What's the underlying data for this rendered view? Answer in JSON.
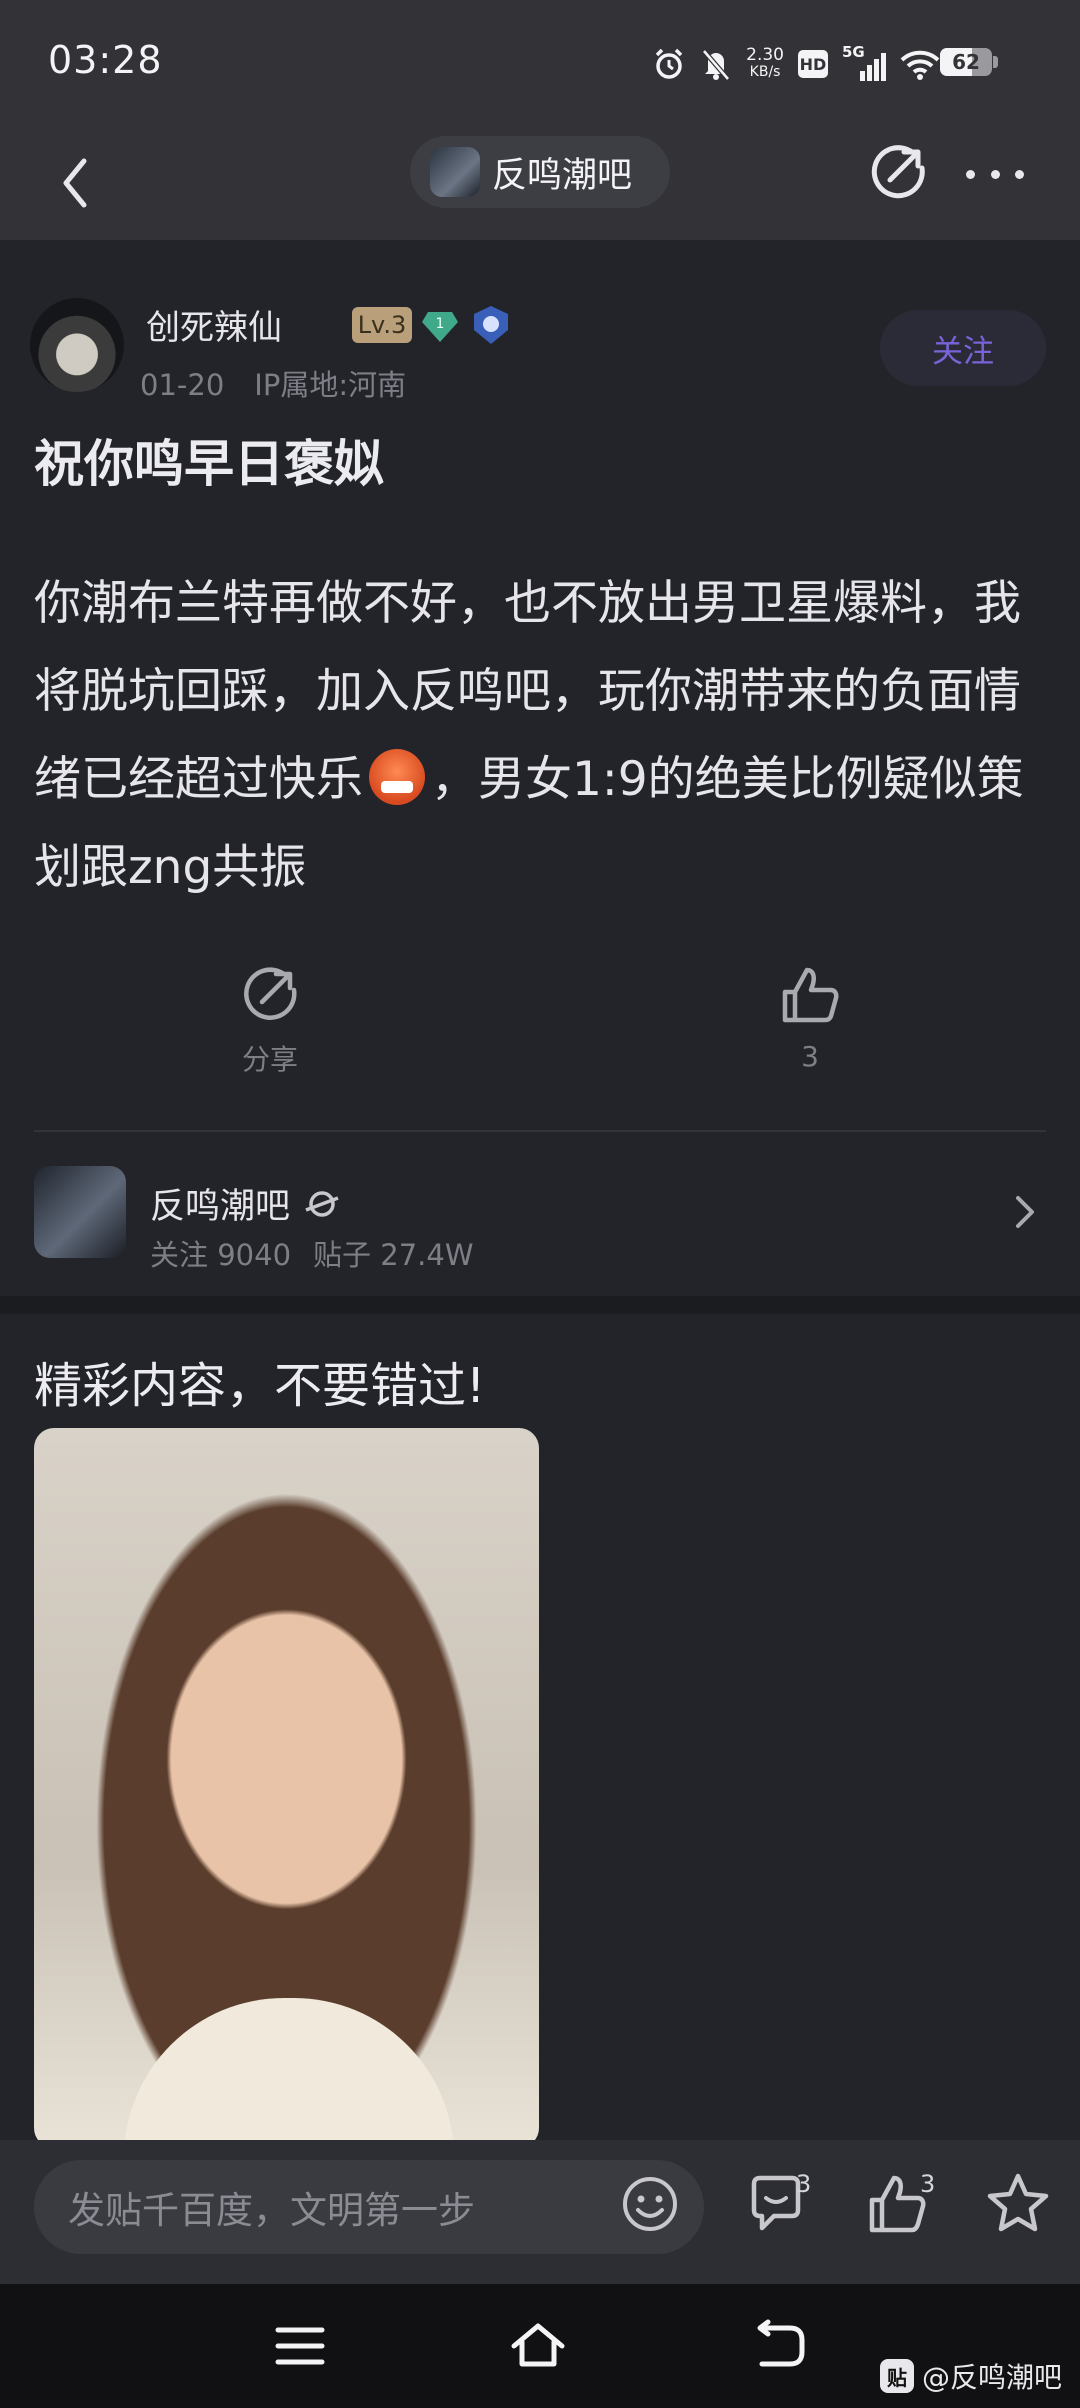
{
  "status_bar": {
    "time": "03:28",
    "net_speed_value": "2.30",
    "net_speed_unit": "KB/s",
    "hd_label": "HD",
    "network_label": "5G",
    "battery_level": "62"
  },
  "nav": {
    "forum_title": "反鸣潮吧"
  },
  "post": {
    "author_name": "创死辣仙",
    "level_badge": "Lv.3",
    "gem_number": "1",
    "date": "01-20",
    "ip_location": "IP属地:河南",
    "follow_label": "关注",
    "title": "祝你鸣早日褒姒",
    "body_before_emoji": "你潮布兰特再做不好，也不放出男卫星爆料，我将脱坑回踩，加入反鸣吧，玩你潮带来的负面情绪已经超过快乐",
    "body_after_emoji": "，男女1:9的绝美比例疑似策划跟zng共振"
  },
  "actions": {
    "share_label": "分享",
    "like_count": "3"
  },
  "forum_card": {
    "name": "反鸣潮吧",
    "follow_stat": "关注 9040",
    "posts_stat": "贴子 27.4W"
  },
  "recommend": {
    "title": "精彩内容，不要错过!"
  },
  "input_bar": {
    "placeholder": "发贴千百度，文明第一步",
    "comment_badge": "3",
    "like_badge": "3"
  },
  "watermark": {
    "logo": "贴",
    "text": "@反鸣潮吧"
  },
  "colors": {
    "background": "#23242a",
    "header": "#333337",
    "accent_follow": "#7a63d8",
    "level_badge": "#b9a07b",
    "muted_text": "#7d7e86"
  },
  "icons": {
    "back": "chevron-left-icon",
    "share": "share-icon",
    "more": "more-icon",
    "like": "thumbs-up-icon",
    "comment": "comment-icon",
    "favorite": "star-icon",
    "emoji": "smiley-icon",
    "menu": "menu-icon",
    "home": "home-icon",
    "return": "return-icon"
  }
}
